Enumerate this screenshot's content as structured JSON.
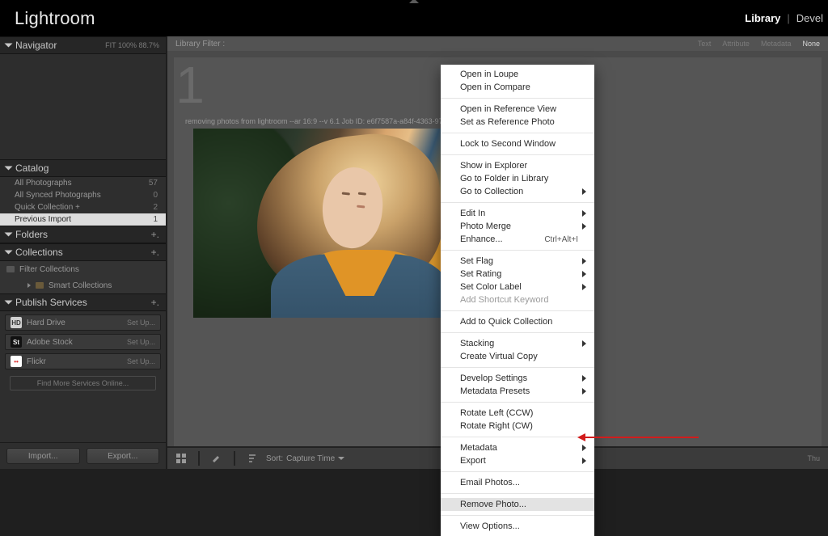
{
  "app": {
    "title": "Lightroom"
  },
  "top_tabs": {
    "active": "Library",
    "other": "Devel"
  },
  "navigator": {
    "title": "Navigator",
    "readout": "FIT   100%   88.7%"
  },
  "catalog": {
    "title": "Catalog",
    "items": [
      {
        "label": "All Photographs",
        "count": "57"
      },
      {
        "label": "All Synced Photographs",
        "count": "0"
      },
      {
        "label": "Quick Collection  +",
        "count": "2"
      },
      {
        "label": "Previous Import",
        "count": "1"
      }
    ],
    "selected_index": 3
  },
  "folders": {
    "title": "Folders"
  },
  "collections": {
    "title": "Collections",
    "filter_label": "Filter Collections",
    "smart_label": "Smart Collections"
  },
  "publish": {
    "title": "Publish Services",
    "services": [
      {
        "icon": "HD",
        "label": "Hard Drive",
        "action": "Set Up..."
      },
      {
        "icon": "St",
        "label": "Adobe Stock",
        "action": "Set Up..."
      },
      {
        "icon": "••",
        "label": "Flickr",
        "action": "Set Up..."
      }
    ],
    "find_more": "Find More Services Online..."
  },
  "bottom_buttons": {
    "import": "Import...",
    "export": "Export..."
  },
  "library_filter": {
    "title": "Library Filter :",
    "links": [
      "Text",
      "Attribute",
      "Metadata",
      "None"
    ],
    "active_index": 3
  },
  "image": {
    "index_badge": "1",
    "caption": "removing photos from lightroom --ar 16:9 --v 6.1 Job ID: e6f7587a-a84f-4363-97c1-c8dc22a639"
  },
  "toolbar": {
    "sort_label": "Sort:",
    "sort_value": "Capture Time",
    "right_text": "Thu"
  },
  "context_menu": {
    "groups": [
      [
        {
          "label": "Open in Loupe"
        },
        {
          "label": "Open in Compare"
        }
      ],
      [
        {
          "label": "Open in Reference View"
        },
        {
          "label": "Set as Reference Photo"
        }
      ],
      [
        {
          "label": "Lock to Second Window"
        }
      ],
      [
        {
          "label": "Show in Explorer"
        },
        {
          "label": "Go to Folder in Library"
        },
        {
          "label": "Go to Collection",
          "submenu": true
        }
      ],
      [
        {
          "label": "Edit In",
          "submenu": true
        },
        {
          "label": "Photo Merge",
          "submenu": true
        },
        {
          "label": "Enhance...",
          "shortcut": "Ctrl+Alt+I"
        }
      ],
      [
        {
          "label": "Set Flag",
          "submenu": true
        },
        {
          "label": "Set Rating",
          "submenu": true
        },
        {
          "label": "Set Color Label",
          "submenu": true
        },
        {
          "label": "Add Shortcut Keyword",
          "disabled": true
        }
      ],
      [
        {
          "label": "Add to Quick Collection"
        }
      ],
      [
        {
          "label": "Stacking",
          "submenu": true
        },
        {
          "label": "Create Virtual Copy"
        }
      ],
      [
        {
          "label": "Develop Settings",
          "submenu": true
        },
        {
          "label": "Metadata Presets",
          "submenu": true
        }
      ],
      [
        {
          "label": "Rotate Left (CCW)"
        },
        {
          "label": "Rotate Right (CW)"
        }
      ],
      [
        {
          "label": "Metadata",
          "submenu": true
        },
        {
          "label": "Export",
          "submenu": true
        }
      ],
      [
        {
          "label": "Email Photos..."
        }
      ],
      [
        {
          "label": "Remove Photo...",
          "highlight": true
        }
      ],
      [
        {
          "label": "View Options..."
        }
      ]
    ]
  }
}
